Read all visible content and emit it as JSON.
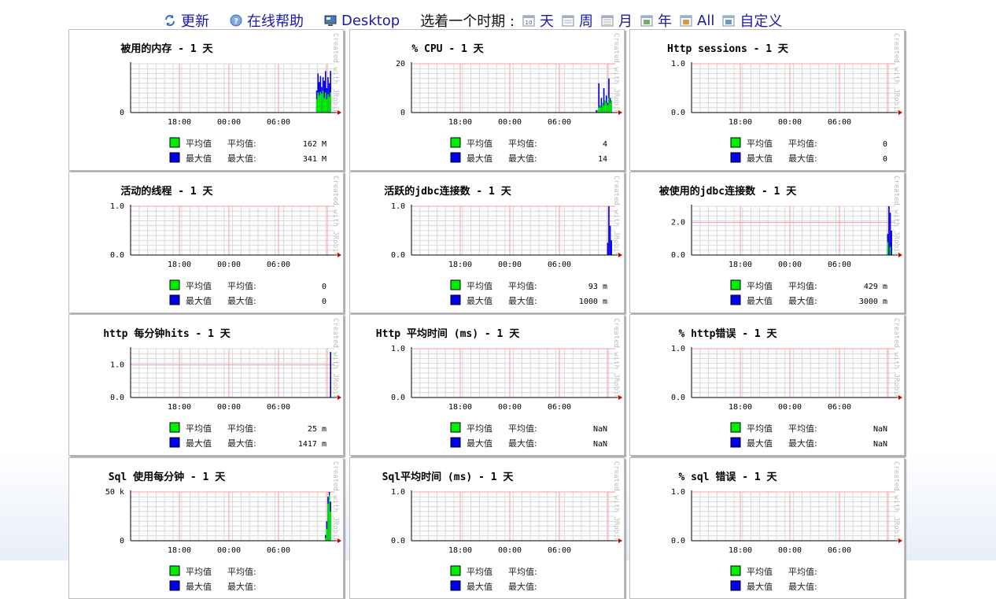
{
  "toolbar": {
    "refresh": "更新",
    "help": "在线帮助",
    "desktop": "Desktop",
    "period_label": "选着一个时期 :",
    "periods": [
      "天",
      "周",
      "月",
      "年",
      "All",
      "自定义"
    ]
  },
  "legend": {
    "avg_name": "平均值",
    "max_name": "最大值",
    "avg_label": "平均值:",
    "max_label": "最大值:"
  },
  "watermark": "Created with JRobin",
  "colors": {
    "avg": "#00ee00",
    "max": "#0000ee",
    "grid_minor": "#d8d8d8",
    "grid_major": "#ff9a9a"
  },
  "chart_data": [
    {
      "type": "bar",
      "title": "被用的内存 - 1 天",
      "x_ticks": [
        "18:00",
        "00:00",
        "06:00"
      ],
      "y_ticks": [
        {
          "v": 0,
          "label": "0"
        }
      ],
      "ylim": [
        0,
        400
      ],
      "avg": [
        0,
        0,
        110,
        165,
        140,
        170,
        155,
        180,
        120,
        165,
        110,
        150,
        130,
        165
      ],
      "max": [
        0,
        0,
        180,
        320,
        250,
        300,
        210,
        290,
        260,
        340,
        200,
        290,
        240,
        341
      ],
      "avg_value": "162 M",
      "max_value": "341 M"
    },
    {
      "type": "bar",
      "title": "% CPU - 1 天",
      "x_ticks": [
        "18:00",
        "00:00",
        "06:00"
      ],
      "y_ticks": [
        {
          "v": 0,
          "label": "0"
        },
        {
          "v": 20,
          "label": "20"
        }
      ],
      "ylim": [
        0,
        20
      ],
      "avg": [
        0,
        0,
        1,
        2,
        3,
        2,
        4,
        3,
        5,
        4,
        3,
        6,
        4,
        5
      ],
      "max": [
        0,
        1,
        0,
        12,
        2,
        6,
        3,
        10,
        5,
        7,
        4,
        14,
        6,
        5
      ],
      "avg_value": "4",
      "max_value": "14"
    },
    {
      "type": "bar",
      "title": "Http sessions - 1 天",
      "x_ticks": [
        "18:00",
        "00:00",
        "06:00"
      ],
      "y_ticks": [
        {
          "v": 0,
          "label": "0.0"
        },
        {
          "v": 1,
          "label": "1.0"
        }
      ],
      "ylim": [
        0,
        1
      ],
      "avg": [],
      "max": [],
      "avg_value": "0",
      "max_value": "0"
    },
    {
      "type": "bar",
      "title": "活动的线程 - 1 天",
      "x_ticks": [
        "18:00",
        "00:00",
        "06:00"
      ],
      "y_ticks": [
        {
          "v": 0,
          "label": "0.0"
        },
        {
          "v": 1,
          "label": "1.0"
        }
      ],
      "ylim": [
        0,
        1
      ],
      "avg": [],
      "max": [],
      "avg_value": "0",
      "max_value": "0"
    },
    {
      "type": "bar",
      "title": "活跃的jdbc连接数 - 1 天",
      "x_ticks": [
        "18:00",
        "00:00",
        "06:00"
      ],
      "y_ticks": [
        {
          "v": 0,
          "label": "0.0"
        },
        {
          "v": 1,
          "label": "1.0"
        }
      ],
      "ylim": [
        0,
        1
      ],
      "avg": [
        0,
        0,
        0,
        0,
        0
      ],
      "max": [
        0,
        0.25,
        1.0,
        0.6,
        0.3
      ],
      "avg_value": "93 m",
      "max_value": "1000 m"
    },
    {
      "type": "bar",
      "title": "被使用的jdbc连接数 - 1 天",
      "x_ticks": [
        "18:00",
        "00:00",
        "06:00"
      ],
      "y_ticks": [
        {
          "v": 0,
          "label": "0.0"
        },
        {
          "v": 2,
          "label": "2.0"
        }
      ],
      "ylim": [
        0,
        3
      ],
      "avg": [
        0,
        0.8,
        0,
        0.5,
        0
      ],
      "max": [
        0,
        1.3,
        3.0,
        2.6,
        1.5
      ],
      "avg_value": "429 m",
      "max_value": "3000 m"
    },
    {
      "type": "bar",
      "title": "http 每分钟hits - 1 天",
      "x_ticks": [
        "18:00",
        "00:00",
        "06:00"
      ],
      "y_ticks": [
        {
          "v": 0,
          "label": "0.0"
        },
        {
          "v": 1,
          "label": "1.0"
        }
      ],
      "ylim": [
        0,
        1.5
      ],
      "avg": [
        0
      ],
      "max": [
        1.4
      ],
      "avg_value": "25 m",
      "max_value": "1417 m"
    },
    {
      "type": "bar",
      "title": "Http 平均时间 (ms) - 1 天",
      "x_ticks": [
        "18:00",
        "00:00",
        "06:00"
      ],
      "y_ticks": [
        {
          "v": 0,
          "label": "0.0"
        },
        {
          "v": 1,
          "label": "1.0"
        }
      ],
      "ylim": [
        0,
        1
      ],
      "avg": [],
      "max": [],
      "avg_value": "NaN",
      "max_value": "NaN"
    },
    {
      "type": "bar",
      "title": "% http错误 - 1 天",
      "x_ticks": [
        "18:00",
        "00:00",
        "06:00"
      ],
      "y_ticks": [
        {
          "v": 0,
          "label": "0.0"
        },
        {
          "v": 1,
          "label": "1.0"
        }
      ],
      "ylim": [
        0,
        1
      ],
      "avg": [],
      "max": [],
      "avg_value": "NaN",
      "max_value": "NaN"
    },
    {
      "type": "bar",
      "title": "Sql 使用每分钟 - 1 天",
      "x_ticks": [
        "18:00",
        "00:00",
        "06:00"
      ],
      "y_ticks": [
        {
          "v": 0,
          "label": "0"
        },
        {
          "v": 50000,
          "label": "50 k"
        }
      ],
      "ylim": [
        0,
        50000
      ],
      "avg": [
        3000,
        12000,
        38000,
        47000,
        30000
      ],
      "max": [
        6000,
        20000,
        45000,
        50000,
        40000
      ],
      "avg_value": "",
      "max_value": ""
    },
    {
      "type": "bar",
      "title": "Sql平均时间 (ms) - 1 天",
      "x_ticks": [
        "18:00",
        "00:00",
        "06:00"
      ],
      "y_ticks": [
        {
          "v": 0,
          "label": "0.0"
        },
        {
          "v": 1,
          "label": "1.0"
        }
      ],
      "ylim": [
        0,
        1
      ],
      "avg": [],
      "max": [],
      "avg_value": "",
      "max_value": ""
    },
    {
      "type": "bar",
      "title": "% sql 错误 - 1 天",
      "x_ticks": [
        "18:00",
        "00:00",
        "06:00"
      ],
      "y_ticks": [
        {
          "v": 0,
          "label": "0.0"
        },
        {
          "v": 1,
          "label": "1.0"
        }
      ],
      "ylim": [
        0,
        1
      ],
      "avg": [],
      "max": [],
      "avg_value": "",
      "max_value": ""
    }
  ]
}
